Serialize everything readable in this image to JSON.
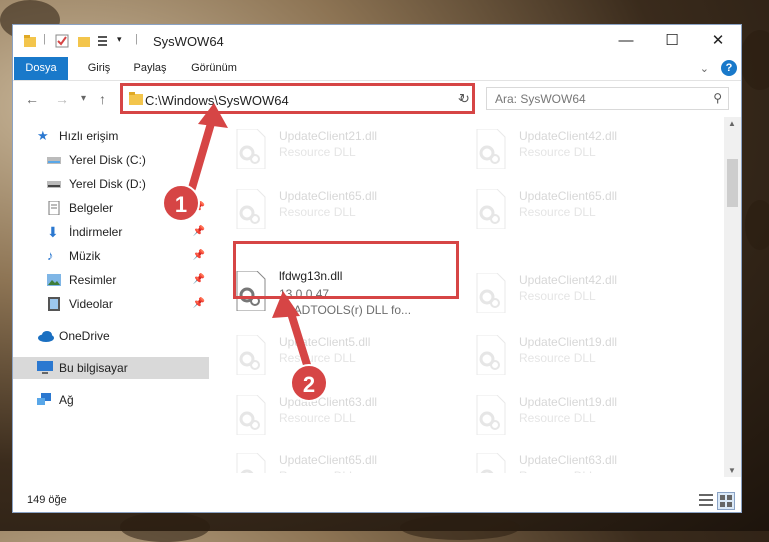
{
  "window": {
    "title": "SysWOW64"
  },
  "window_controls": {
    "minimize": "—",
    "maximize": "☐",
    "close": "✕"
  },
  "ribbon": {
    "tabs": [
      "Dosya",
      "Giriş",
      "Paylaş",
      "Görünüm"
    ],
    "help": "?"
  },
  "nav": {
    "address": "C:\\Windows\\SysWOW64",
    "search_placeholder": "Ara: SysWOW64"
  },
  "sidebar": {
    "items": [
      {
        "label": "Hızlı erişim",
        "icon": "star-icon"
      },
      {
        "label": "Yerel Disk (C:)",
        "icon": "drive-icon"
      },
      {
        "label": "Yerel Disk (D:)",
        "icon": "drive-icon"
      },
      {
        "label": "Belgeler",
        "icon": "documents-icon"
      },
      {
        "label": "İndirmeler",
        "icon": "download-icon"
      },
      {
        "label": "Müzik",
        "icon": "music-icon"
      },
      {
        "label": "Resimler",
        "icon": "pictures-icon"
      },
      {
        "label": "Videolar",
        "icon": "video-icon"
      },
      {
        "label": "OneDrive",
        "icon": "cloud-icon"
      },
      {
        "label": "Bu bilgisayar",
        "icon": "computer-icon"
      },
      {
        "label": "Ağ",
        "icon": "network-icon"
      }
    ]
  },
  "files": {
    "left": [
      {
        "name": "UpdateClient21.dll",
        "type": "Resource DLL"
      },
      {
        "name": "UpdateClient65.dll",
        "type": "Resource DLL"
      },
      {
        "name": "lfdwg13n.dll",
        "version": "13.0.0.47",
        "desc": "LEADTOOLS(r) DLL fo..."
      },
      {
        "name": "UpdateClient5.dll",
        "type": "Resource DLL"
      },
      {
        "name": "UpdateClient63.dll",
        "type": "Resource DLL"
      },
      {
        "name": "UpdateClient65.dll",
        "type": "Resource DLL"
      }
    ],
    "right": [
      {
        "name": "UpdateClient42.dll",
        "type": "Resource DLL"
      },
      {
        "name": "UpdateClient65.dll",
        "type": "Resource DLL"
      },
      {
        "name": "UpdateClient42.dll",
        "type": "Resource DLL"
      },
      {
        "name": "UpdateClient19.dll",
        "type": "Resource DLL"
      },
      {
        "name": "UpdateClient19.dll",
        "type": "Resource DLL"
      },
      {
        "name": "UpdateClient63.dll",
        "type": "Resource DLL"
      }
    ]
  },
  "status": {
    "count": "149 öğe"
  },
  "annotations": {
    "step1": "1",
    "step2": "2"
  },
  "colors": {
    "accent": "#1979ca",
    "highlight": "#d64545"
  }
}
